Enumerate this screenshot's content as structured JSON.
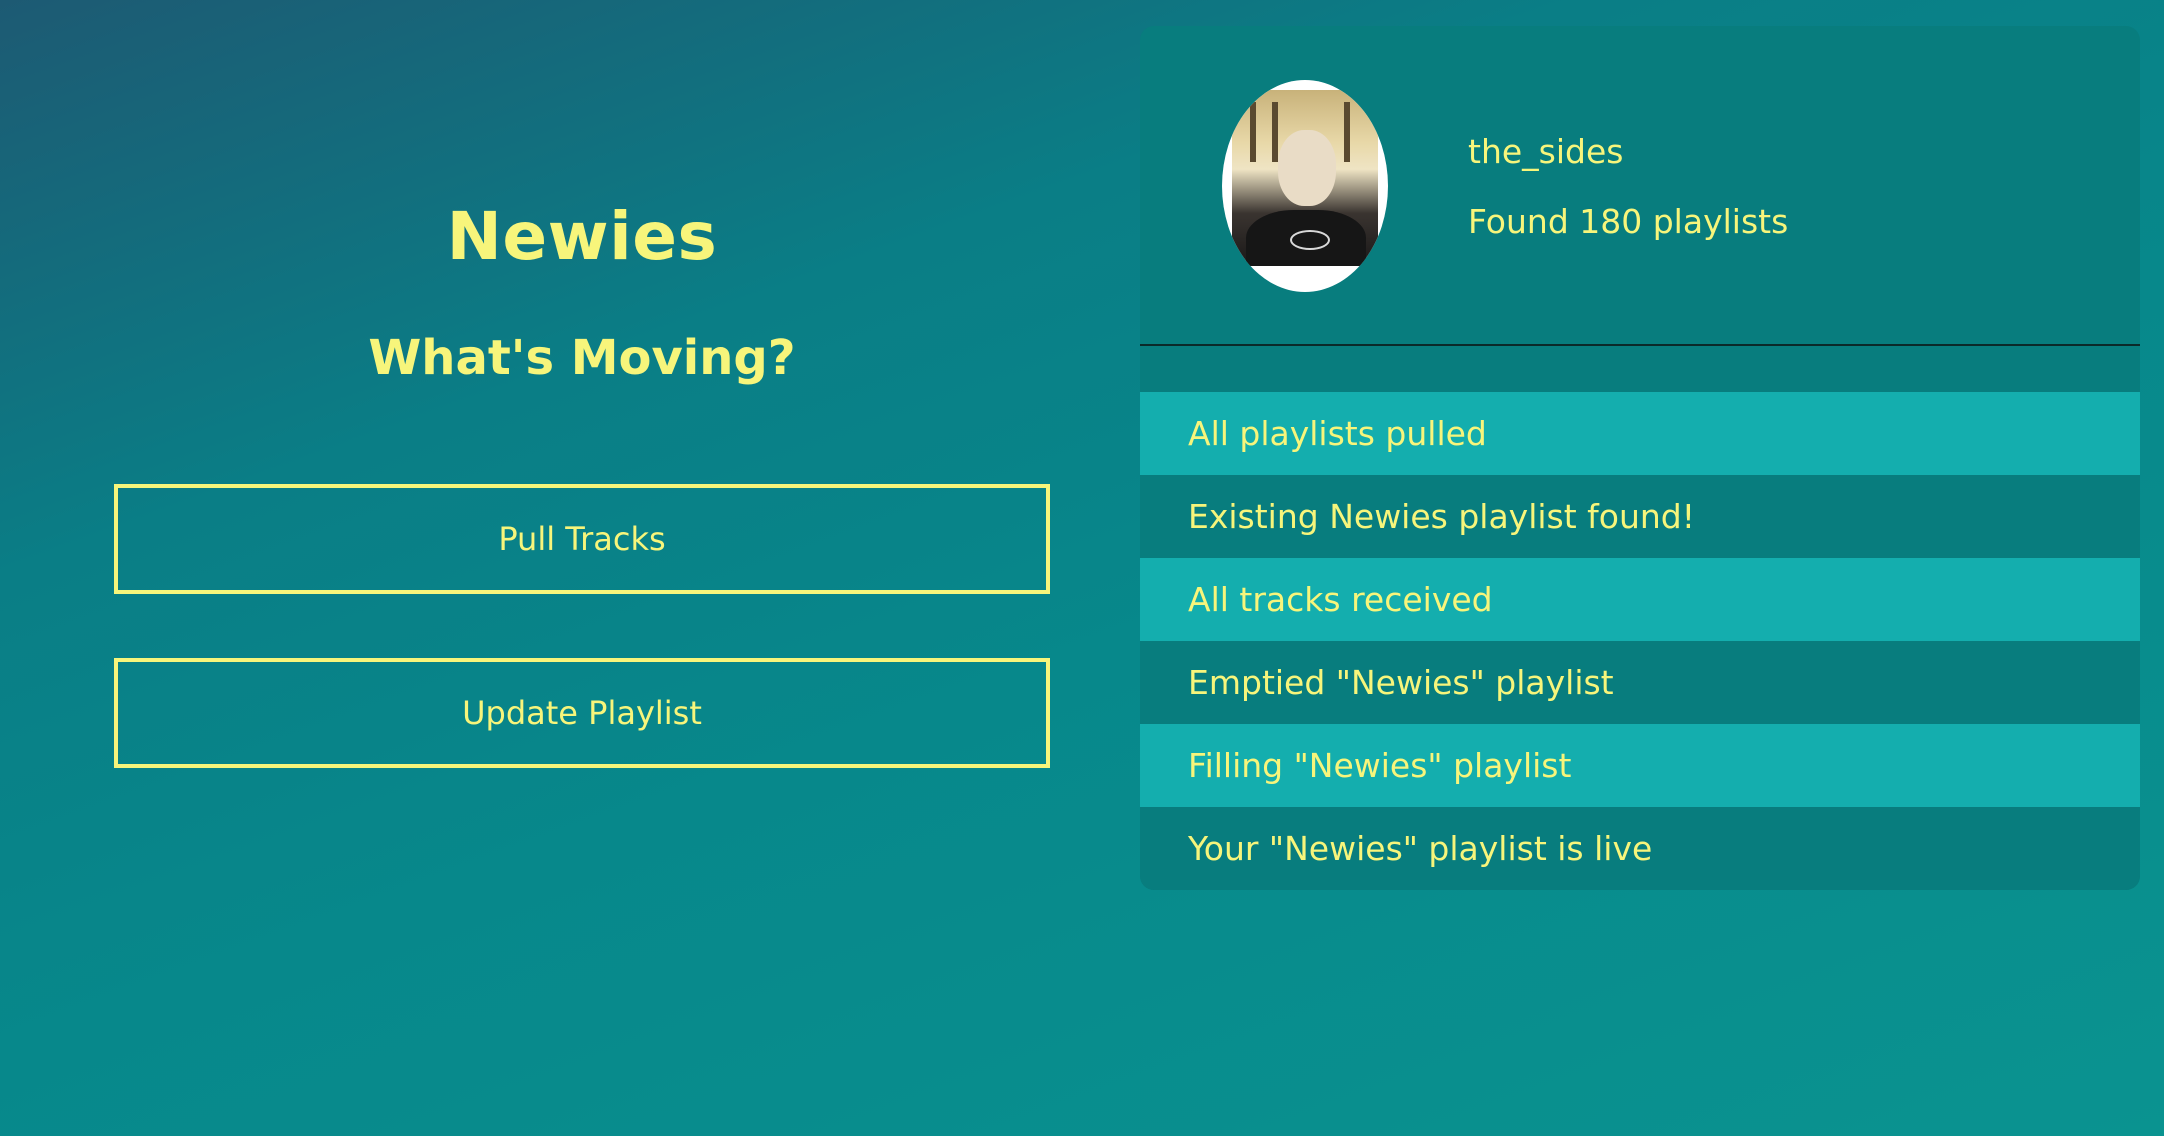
{
  "app": {
    "title": "Newies",
    "subtitle": "What's Moving?"
  },
  "actions": {
    "pull_label": "Pull Tracks",
    "update_label": "Update Playlist"
  },
  "profile": {
    "username": "the_sides",
    "playlist_count_text": "Found 180 playlists"
  },
  "status_log": [
    "All playlists pulled",
    "Existing Newies playlist found!",
    "All tracks received",
    "Emptied \"Newies\" playlist",
    "Filling \"Newies\" playlist",
    "Your \"Newies\" playlist is live"
  ],
  "colors": {
    "accent_text": "#f7f57b",
    "panel": "#087d7e",
    "row_highlight": "#14aeae"
  }
}
